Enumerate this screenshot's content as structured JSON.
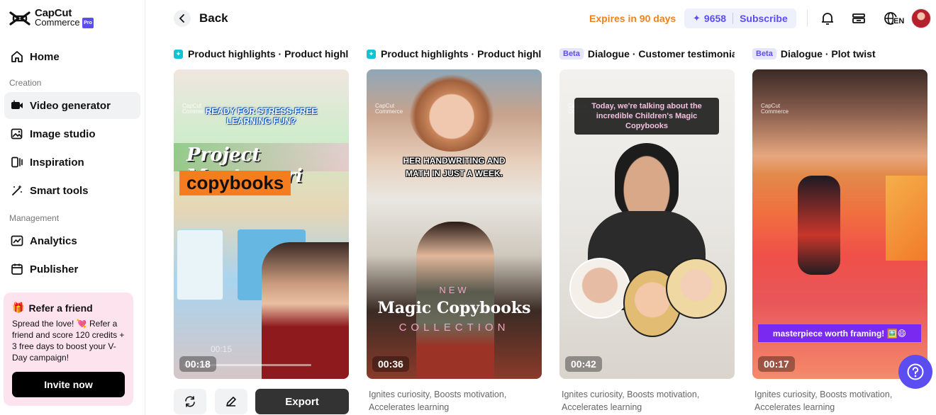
{
  "brand": {
    "name": "CapCut",
    "sub": "Commerce",
    "badge": "Pro"
  },
  "nav": {
    "home": "Home",
    "creation_label": "Creation",
    "creation_items": [
      "Video generator",
      "Image studio",
      "Inspiration",
      "Smart tools"
    ],
    "management_label": "Management",
    "management_items": [
      "Analytics",
      "Publisher"
    ]
  },
  "refer": {
    "title": "Refer a friend",
    "body": "Spread the love! 💘 Refer a friend and score 120 credits + 3 free days to boost your V-Day campaign!",
    "button": "Invite now"
  },
  "header": {
    "back": "Back",
    "expires": "Expires in 90 days",
    "credits": "9658",
    "subscribe": "Subscribe",
    "lang": "EN"
  },
  "cards": [
    {
      "title": "Product highlights · Product highl...",
      "duration": "00:18",
      "overlay": [
        "READY FOR STRESS-FREE",
        "LEARNING FUN?"
      ],
      "headline": "Project Montessori",
      "headline2": "copybooks",
      "player_time": "00:15",
      "desc": ""
    },
    {
      "title": "Product highlights · Product highl...",
      "duration": "00:36",
      "overlay": [
        "HER HANDWRITING AND",
        "MATH IN JUST A WEEK."
      ],
      "headline": "NEW",
      "headline2": "Magic Copybooks",
      "headline3": "COLLECTION",
      "desc": "Ignites curiosity, Boosts motivation, Accelerates learning"
    },
    {
      "badge": "Beta",
      "title": "Dialogue · Customer testimonial",
      "duration": "00:42",
      "overlay": "Today, we're talking about the incredible Children's Magic Copybooks",
      "desc": "Ignites curiosity, Boosts motivation, Accelerates learning"
    },
    {
      "badge": "Beta",
      "title": "Dialogue · Plot twist",
      "duration": "00:17",
      "overlay": "masterpiece worth framing! 🖼️😄",
      "desc": "Ignites curiosity, Boosts motivation, Accelerates learning"
    }
  ],
  "actions": {
    "export": "Export"
  },
  "colors": {
    "accent": "#5b4df0",
    "expires": "#f0821e",
    "active_nav": "#f1f2f4"
  }
}
